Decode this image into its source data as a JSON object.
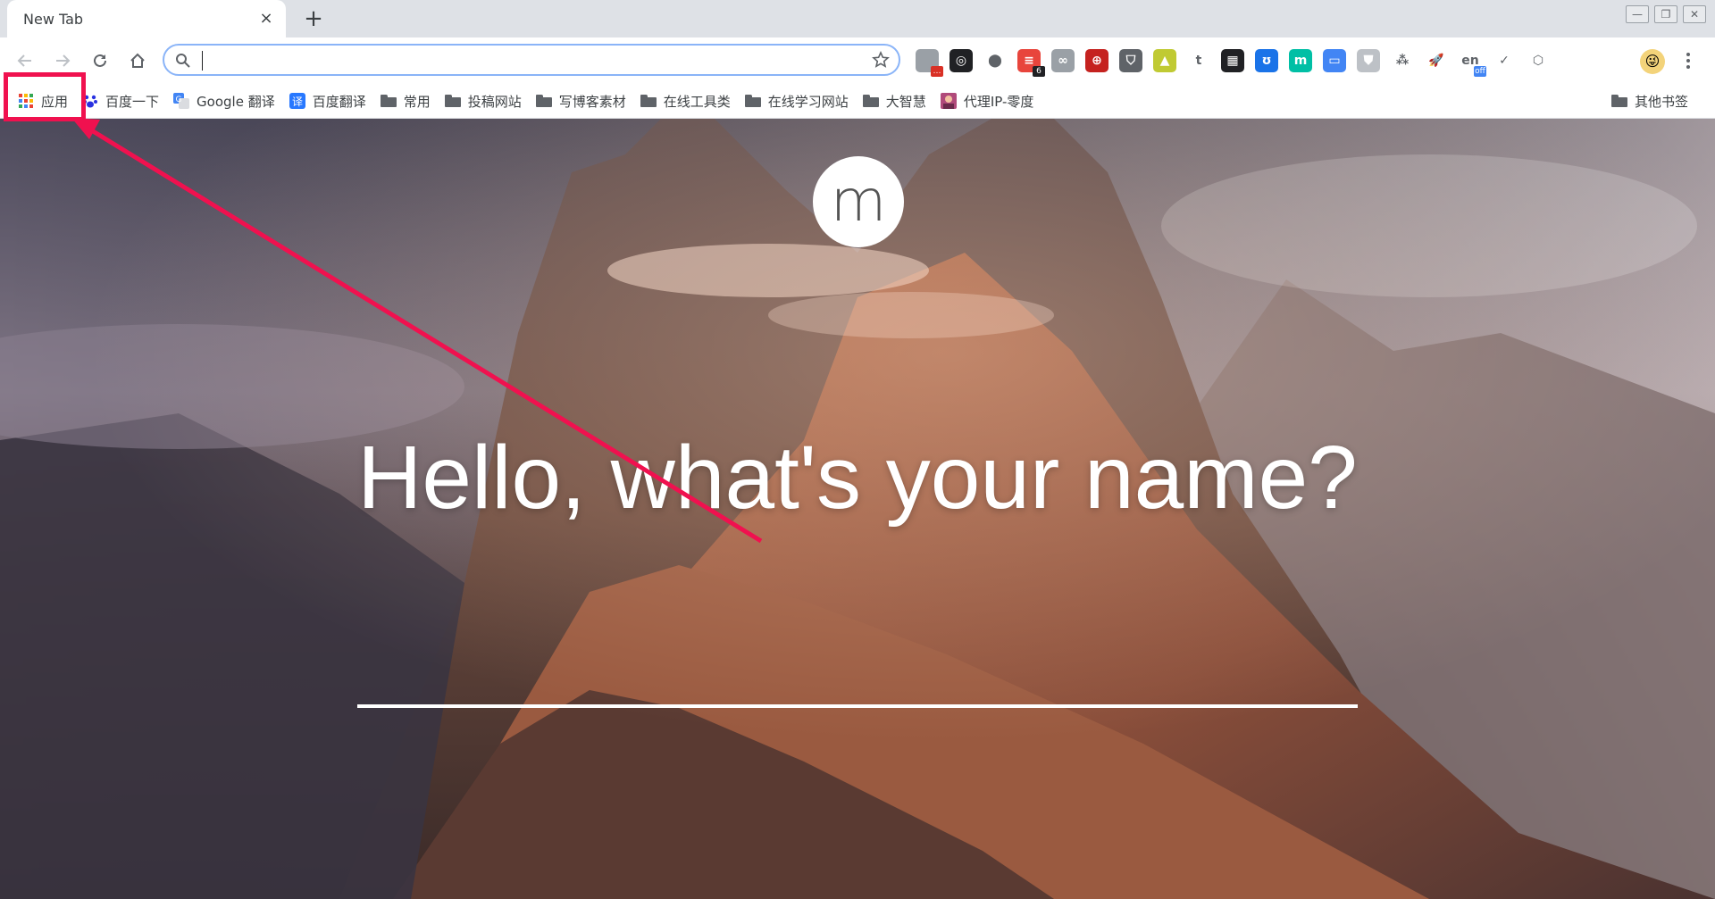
{
  "tab": {
    "title": "New Tab",
    "close_glyph": "×"
  },
  "new_tab_glyph": "+",
  "window_controls": {
    "minimize": "—",
    "restore": "❐",
    "close": "✕"
  },
  "toolbar": {
    "omnibox_value": "",
    "extensions": [
      {
        "name": "extension-puzzle-icon",
        "bg": "#9aa0a6",
        "glyph": "",
        "badge": "…",
        "badge_bg": "#d93025"
      },
      {
        "name": "camera-extension-icon",
        "bg": "#202124",
        "glyph": "◎",
        "badge": ""
      },
      {
        "name": "ring-extension-icon",
        "bg": "#ffffff",
        "glyph": "⬤",
        "badge": ""
      },
      {
        "name": "stack-extension-icon",
        "bg": "#e8453c",
        "glyph": "≡",
        "badge": "6",
        "badge_bg": "#202124"
      },
      {
        "name": "glasses-extension-icon",
        "bg": "#9aa0a6",
        "glyph": "∞",
        "badge": ""
      },
      {
        "name": "lifesaver-extension-icon",
        "bg": "#c5221f",
        "glyph": "⊕",
        "badge": ""
      },
      {
        "name": "shield-ublock-extension-icon",
        "bg": "#5f6368",
        "glyph": "⛉",
        "badge": ""
      },
      {
        "name": "landscape-extension-icon",
        "bg": "#c0ca33",
        "glyph": "▲",
        "badge": ""
      },
      {
        "name": "tumblr-extension-icon",
        "bg": "#ffffff",
        "glyph": "t",
        "badge": ""
      },
      {
        "name": "qr-code-extension-icon",
        "bg": "#202124",
        "glyph": "▦",
        "badge": ""
      },
      {
        "name": "bear-extension-icon",
        "bg": "#1a73e8",
        "glyph": "ʊ",
        "badge": ""
      },
      {
        "name": "m-circle-extension-icon",
        "bg": "#00bfa5",
        "glyph": "m",
        "badge": ""
      },
      {
        "name": "window-extension-icon",
        "bg": "#4285f4",
        "glyph": "▭",
        "badge": ""
      },
      {
        "name": "shield-extension-icon",
        "bg": "#bdc1c6",
        "glyph": "⛊",
        "badge": ""
      },
      {
        "name": "tree-extension-icon",
        "bg": "#ffffff",
        "glyph": "⁂",
        "badge": ""
      },
      {
        "name": "rocket-extension-icon",
        "bg": "#ffffff",
        "glyph": "🚀",
        "badge": ""
      },
      {
        "name": "translate-off-extension-icon",
        "bg": "#ffffff",
        "glyph": "en",
        "badge": "off",
        "badge_bg": "#4285f4"
      },
      {
        "name": "checkmark-extension-icon",
        "bg": "#ffffff",
        "glyph": "✓",
        "badge": ""
      },
      {
        "name": "hexagon-extension-icon",
        "bg": "#ffffff",
        "glyph": "⬡",
        "badge": ""
      }
    ],
    "profile_glyph": "😜"
  },
  "bookmarks": {
    "items": [
      {
        "name": "bookmark-apps",
        "label": "应用",
        "icon": "apps-grid-icon"
      },
      {
        "name": "bookmark-baidu",
        "label": "百度一下",
        "icon": "baidu-paw-icon"
      },
      {
        "name": "bookmark-google-translate",
        "label": "Google 翻译",
        "icon": "google-translate-icon"
      },
      {
        "name": "bookmark-baidu-translate",
        "label": "百度翻译",
        "icon": "baidu-translate-icon"
      },
      {
        "name": "bookmark-folder-common",
        "label": "常用",
        "icon": "folder-icon"
      },
      {
        "name": "bookmark-folder-submission",
        "label": "投稿网站",
        "icon": "folder-icon"
      },
      {
        "name": "bookmark-folder-blog-material",
        "label": "写博客素材",
        "icon": "folder-icon"
      },
      {
        "name": "bookmark-folder-online-tools",
        "label": "在线工具类",
        "icon": "folder-icon"
      },
      {
        "name": "bookmark-folder-online-learning",
        "label": "在线学习网站",
        "icon": "folder-icon"
      },
      {
        "name": "bookmark-folder-dazhihui",
        "label": "大智慧",
        "icon": "folder-icon"
      },
      {
        "name": "bookmark-proxy-ip",
        "label": "代理IP-零度",
        "icon": "proxy-avatar-icon"
      }
    ],
    "other_label": "其他书签"
  },
  "momentum": {
    "logo_letter": "m",
    "question": "Hello, what's your name?",
    "name_value": ""
  },
  "colors": {
    "annotation": "#f0114f",
    "omnibox_border": "#8ab4f8"
  }
}
